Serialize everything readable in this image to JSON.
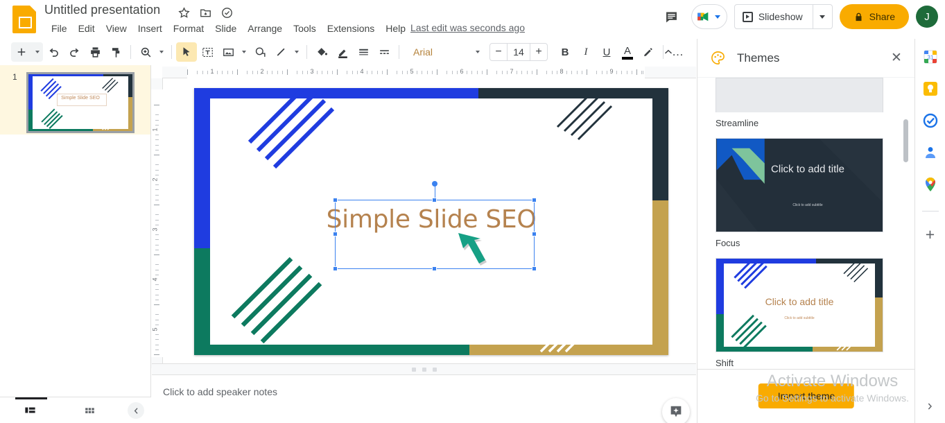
{
  "app": {
    "name": "Google Slides"
  },
  "header": {
    "doc_title": "Untitled presentation",
    "title_icons": [
      "star-icon",
      "move-to-folder-icon",
      "cloud-saved-icon"
    ],
    "menus": [
      "File",
      "Edit",
      "View",
      "Insert",
      "Format",
      "Slide",
      "Arrange",
      "Tools",
      "Extensions",
      "Help"
    ],
    "last_edit": "Last edit was seconds ago",
    "comment_icon": "comment-icon",
    "meet_icon": "google-meet-icon",
    "slideshow_label": "Slideshow",
    "share_label": "Share",
    "share_icon": "lock-icon",
    "avatar_initial": "J",
    "share_color": "#f9ab00",
    "avatar_color": "#1e6b3a"
  },
  "toolbar": {
    "items": [
      "new-slide-icon",
      "undo-icon",
      "redo-icon",
      "print-icon",
      "paint-format-icon",
      "zoom-icon",
      "select-icon",
      "textbox-icon",
      "image-icon",
      "shape-icon",
      "line-icon",
      "fill-color-icon",
      "line-color-icon",
      "line-weight-icon",
      "line-dash-icon"
    ],
    "font_name": "Arial",
    "font_size": "14",
    "decrease_label": "−",
    "increase_label": "+",
    "bold_label": "B",
    "italic_label": "I",
    "underline_label": "U",
    "text_color_label": "A",
    "highlight_icon": "highlight-pen-icon",
    "more_label": "…",
    "collapse_icon": "chevron-up-icon",
    "active_tool": "select-icon"
  },
  "ruler": {
    "horizontal": [
      "1",
      "2",
      "3",
      "4",
      "5",
      "6",
      "7",
      "8",
      "9"
    ],
    "vertical": [
      "1",
      "2",
      "3",
      "4",
      "5"
    ]
  },
  "filmstrip": {
    "slides": [
      {
        "number": "1",
        "title": "Simple Slide SEO",
        "selected": true
      }
    ],
    "view_modes": [
      "filmstrip-view-icon",
      "grid-view-icon"
    ],
    "active_view": "filmstrip-view-icon",
    "collapse_icon": "chevron-left-icon"
  },
  "slide": {
    "title": "Simple Slide SEO",
    "theme": "Shift",
    "colors": {
      "blue": "#1f3ce0",
      "navy": "#22323c",
      "teal": "#0d7a5f",
      "gold": "#c4a24f",
      "title_text": "#b5824e"
    },
    "selection": {
      "visible": true,
      "handles": 8,
      "rotation_handle": true,
      "color": "#3b82f0"
    },
    "annotation": {
      "type": "arrow",
      "color": "#16a085"
    }
  },
  "notes": {
    "placeholder": "Click to add speaker notes",
    "explore_icon": "explore-sparkle-icon"
  },
  "themes_panel": {
    "icon": "palette-icon",
    "title": "Themes",
    "close_icon": "close-icon",
    "items": [
      {
        "name": "Streamline",
        "partial": true
      },
      {
        "name": "Focus",
        "title_ph": "Click to add title",
        "sub_ph": "Click to add subtitle"
      },
      {
        "name": "Shift",
        "title_ph": "Click to add title",
        "sub_ph": "Click to add subtitle"
      }
    ],
    "import_label": "Import theme"
  },
  "rail": {
    "icons": [
      "google-calendar-icon",
      "google-keep-icon",
      "google-tasks-icon",
      "google-contacts-icon",
      "google-maps-icon"
    ],
    "add_label": "+",
    "expand_icon": "chevron-right-icon"
  },
  "watermark": {
    "line1": "Activate Windows",
    "line2": "Go to Settings to activate Windows."
  }
}
